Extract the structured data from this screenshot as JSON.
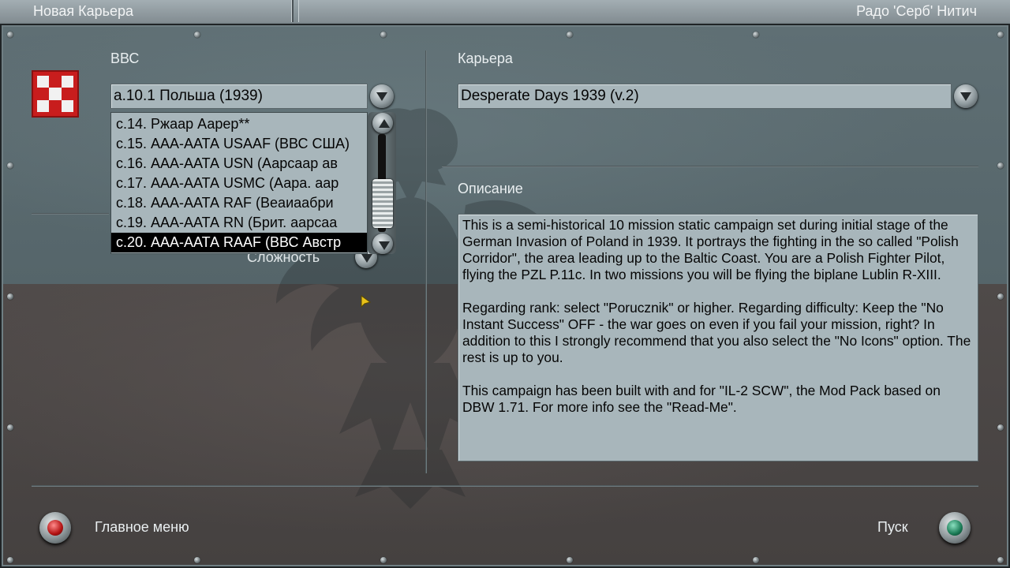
{
  "titlebar": {
    "left_title": "Новая Карьера",
    "right_title": "Радо 'Серб' Нитич"
  },
  "left": {
    "air_force_label": "ВВС",
    "unit_combo_value": "a.10.1 Польша (1939)",
    "difficulty_label": "Сложность",
    "unit_list": [
      "с.14. Ржаар Аарер**",
      "с.15. ААА-ААТА USAAF (ВВС США)",
      "с.16. ААА-ААТА USN (Аарсаар ав",
      "с.17. ААА-ААТА USMC (Аара. аар",
      "с.18. ААА-ААТА RAF (Веаиаабри",
      "с.19. ААА-ААТА RN (Брит. аарсаа",
      "с.20. ААА-ААТА RAAF (ВВС Австр"
    ],
    "selected_index": 6
  },
  "right": {
    "career_label": "Карьера",
    "career_combo_value": "Desperate Days 1939 (v.2)",
    "description_label": "Описание",
    "description_paragraphs": [
      "This is a semi-historical 10 mission static campaign set during initial stage of the German Invasion of Poland in 1939. It portrays the fighting in the so called \"Polish Corridor\", the area leading up to the Baltic Coast. You are a Polish Fighter Pilot, flying the PZL P.11c. In two missions you will be flying the biplane Lublin R-XIII.",
      "Regarding rank: select \"Porucznik\" or higher. Regarding difficulty: Keep the \"No Instant Success\" OFF - the war goes on even if you fail your mission, right? In addition to this I strongly recommend that you also select the \"No Icons\" option. The rest is up to you.",
      "This campaign has been built with and for \"IL-2 SCW\", the Mod Pack based on DBW 1.71. For more info see the \"Read-Me\"."
    ]
  },
  "footer": {
    "main_menu_label": "Главное меню",
    "start_label": "Пуск"
  },
  "colors": {
    "field_bg": "#a8b6bb",
    "flag_red": "#c81d1d",
    "flag_white": "#f1f1f1"
  }
}
